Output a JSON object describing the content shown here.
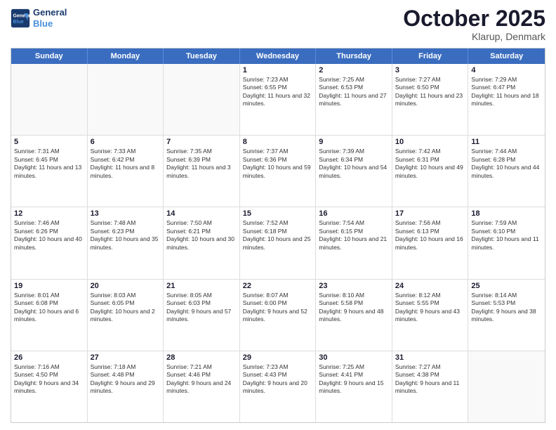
{
  "logo": {
    "line1": "General",
    "line2": "Blue"
  },
  "title": "October 2025",
  "location": "Klarup, Denmark",
  "header": {
    "days": [
      "Sunday",
      "Monday",
      "Tuesday",
      "Wednesday",
      "Thursday",
      "Friday",
      "Saturday"
    ]
  },
  "weeks": [
    [
      {
        "day": "",
        "sunrise": "",
        "sunset": "",
        "daylight": "",
        "empty": true
      },
      {
        "day": "",
        "sunrise": "",
        "sunset": "",
        "daylight": "",
        "empty": true
      },
      {
        "day": "",
        "sunrise": "",
        "sunset": "",
        "daylight": "",
        "empty": true
      },
      {
        "day": "1",
        "sunrise": "Sunrise: 7:23 AM",
        "sunset": "Sunset: 6:55 PM",
        "daylight": "Daylight: 11 hours and 32 minutes."
      },
      {
        "day": "2",
        "sunrise": "Sunrise: 7:25 AM",
        "sunset": "Sunset: 6:53 PM",
        "daylight": "Daylight: 11 hours and 27 minutes."
      },
      {
        "day": "3",
        "sunrise": "Sunrise: 7:27 AM",
        "sunset": "Sunset: 6:50 PM",
        "daylight": "Daylight: 11 hours and 23 minutes."
      },
      {
        "day": "4",
        "sunrise": "Sunrise: 7:29 AM",
        "sunset": "Sunset: 6:47 PM",
        "daylight": "Daylight: 11 hours and 18 minutes."
      }
    ],
    [
      {
        "day": "5",
        "sunrise": "Sunrise: 7:31 AM",
        "sunset": "Sunset: 6:45 PM",
        "daylight": "Daylight: 11 hours and 13 minutes."
      },
      {
        "day": "6",
        "sunrise": "Sunrise: 7:33 AM",
        "sunset": "Sunset: 6:42 PM",
        "daylight": "Daylight: 11 hours and 8 minutes."
      },
      {
        "day": "7",
        "sunrise": "Sunrise: 7:35 AM",
        "sunset": "Sunset: 6:39 PM",
        "daylight": "Daylight: 11 hours and 3 minutes."
      },
      {
        "day": "8",
        "sunrise": "Sunrise: 7:37 AM",
        "sunset": "Sunset: 6:36 PM",
        "daylight": "Daylight: 10 hours and 59 minutes."
      },
      {
        "day": "9",
        "sunrise": "Sunrise: 7:39 AM",
        "sunset": "Sunset: 6:34 PM",
        "daylight": "Daylight: 10 hours and 54 minutes."
      },
      {
        "day": "10",
        "sunrise": "Sunrise: 7:42 AM",
        "sunset": "Sunset: 6:31 PM",
        "daylight": "Daylight: 10 hours and 49 minutes."
      },
      {
        "day": "11",
        "sunrise": "Sunrise: 7:44 AM",
        "sunset": "Sunset: 6:28 PM",
        "daylight": "Daylight: 10 hours and 44 minutes."
      }
    ],
    [
      {
        "day": "12",
        "sunrise": "Sunrise: 7:46 AM",
        "sunset": "Sunset: 6:26 PM",
        "daylight": "Daylight: 10 hours and 40 minutes."
      },
      {
        "day": "13",
        "sunrise": "Sunrise: 7:48 AM",
        "sunset": "Sunset: 6:23 PM",
        "daylight": "Daylight: 10 hours and 35 minutes."
      },
      {
        "day": "14",
        "sunrise": "Sunrise: 7:50 AM",
        "sunset": "Sunset: 6:21 PM",
        "daylight": "Daylight: 10 hours and 30 minutes."
      },
      {
        "day": "15",
        "sunrise": "Sunrise: 7:52 AM",
        "sunset": "Sunset: 6:18 PM",
        "daylight": "Daylight: 10 hours and 25 minutes."
      },
      {
        "day": "16",
        "sunrise": "Sunrise: 7:54 AM",
        "sunset": "Sunset: 6:15 PM",
        "daylight": "Daylight: 10 hours and 21 minutes."
      },
      {
        "day": "17",
        "sunrise": "Sunrise: 7:56 AM",
        "sunset": "Sunset: 6:13 PM",
        "daylight": "Daylight: 10 hours and 16 minutes."
      },
      {
        "day": "18",
        "sunrise": "Sunrise: 7:59 AM",
        "sunset": "Sunset: 6:10 PM",
        "daylight": "Daylight: 10 hours and 11 minutes."
      }
    ],
    [
      {
        "day": "19",
        "sunrise": "Sunrise: 8:01 AM",
        "sunset": "Sunset: 6:08 PM",
        "daylight": "Daylight: 10 hours and 6 minutes."
      },
      {
        "day": "20",
        "sunrise": "Sunrise: 8:03 AM",
        "sunset": "Sunset: 6:05 PM",
        "daylight": "Daylight: 10 hours and 2 minutes."
      },
      {
        "day": "21",
        "sunrise": "Sunrise: 8:05 AM",
        "sunset": "Sunset: 6:03 PM",
        "daylight": "Daylight: 9 hours and 57 minutes."
      },
      {
        "day": "22",
        "sunrise": "Sunrise: 8:07 AM",
        "sunset": "Sunset: 6:00 PM",
        "daylight": "Daylight: 9 hours and 52 minutes."
      },
      {
        "day": "23",
        "sunrise": "Sunrise: 8:10 AM",
        "sunset": "Sunset: 5:58 PM",
        "daylight": "Daylight: 9 hours and 48 minutes."
      },
      {
        "day": "24",
        "sunrise": "Sunrise: 8:12 AM",
        "sunset": "Sunset: 5:55 PM",
        "daylight": "Daylight: 9 hours and 43 minutes."
      },
      {
        "day": "25",
        "sunrise": "Sunrise: 8:14 AM",
        "sunset": "Sunset: 5:53 PM",
        "daylight": "Daylight: 9 hours and 38 minutes."
      }
    ],
    [
      {
        "day": "26",
        "sunrise": "Sunrise: 7:16 AM",
        "sunset": "Sunset: 4:50 PM",
        "daylight": "Daylight: 9 hours and 34 minutes."
      },
      {
        "day": "27",
        "sunrise": "Sunrise: 7:18 AM",
        "sunset": "Sunset: 4:48 PM",
        "daylight": "Daylight: 9 hours and 29 minutes."
      },
      {
        "day": "28",
        "sunrise": "Sunrise: 7:21 AM",
        "sunset": "Sunset: 4:46 PM",
        "daylight": "Daylight: 9 hours and 24 minutes."
      },
      {
        "day": "29",
        "sunrise": "Sunrise: 7:23 AM",
        "sunset": "Sunset: 4:43 PM",
        "daylight": "Daylight: 9 hours and 20 minutes."
      },
      {
        "day": "30",
        "sunrise": "Sunrise: 7:25 AM",
        "sunset": "Sunset: 4:41 PM",
        "daylight": "Daylight: 9 hours and 15 minutes."
      },
      {
        "day": "31",
        "sunrise": "Sunrise: 7:27 AM",
        "sunset": "Sunset: 4:38 PM",
        "daylight": "Daylight: 9 hours and 11 minutes."
      },
      {
        "day": "",
        "sunrise": "",
        "sunset": "",
        "daylight": "",
        "empty": true
      }
    ]
  ]
}
